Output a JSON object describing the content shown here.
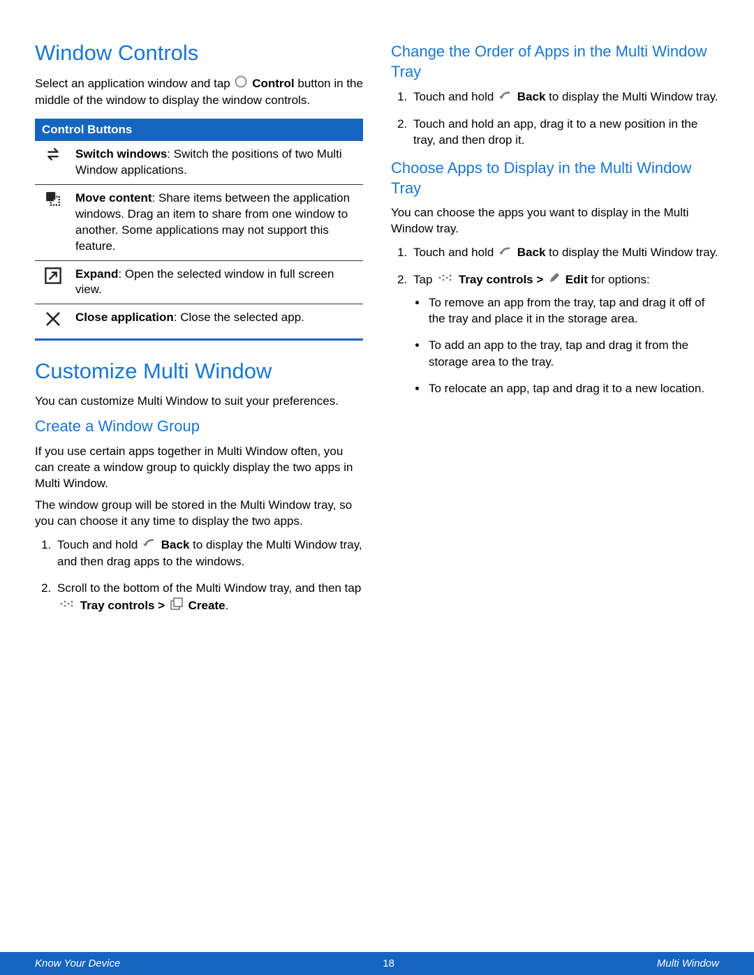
{
  "left": {
    "h1_windowControls": "Window Controls",
    "intro1a": "Select an application window and tap ",
    "intro1b": "Control",
    "intro1c": " button in the middle of the window to display the window controls.",
    "controlButtonsHeader": "Control Buttons",
    "rows": [
      {
        "icon": "switch",
        "bold": "Switch windows",
        "rest": ": Switch the positions of two Multi Window applications."
      },
      {
        "icon": "move",
        "bold": "Move content",
        "rest": ": Share items between the application windows. Drag an item to share from one window to another. Some applications may not support this feature."
      },
      {
        "icon": "expand",
        "bold": "Expand",
        "rest": ": Open the selected window in full screen view."
      },
      {
        "icon": "close",
        "bold": "Close application",
        "rest": ": Close the selected app."
      }
    ],
    "h1_customize": "Customize Multi Window",
    "customize_p": "You can customize Multi Window to suit your preferences.",
    "h2_createGroup": "Create a Window Group",
    "createGroup_p1": "If you use certain apps together in Multi Window often, you can create a window group to quickly display the two apps in Multi Window.",
    "createGroup_p2": "The window group will be stored in the Multi Window tray, so you can choose it any time to display the two apps.",
    "createGroup_li1a": "Touch and hold ",
    "createGroup_li1_back": "Back",
    "createGroup_li1b": " to display the Multi Window tray, and then drag apps to the windows.",
    "createGroup_li2a": "Scroll to the bottom of the Multi Window tray, and then tap ",
    "createGroup_li2_tray": "Tray controls > ",
    "createGroup_li2_create": "Create",
    "createGroup_li2b": "."
  },
  "right": {
    "h2_changeOrder": "Change the Order of Apps in the Multi Window Tray",
    "changeOrder_li1a": "Touch and hold ",
    "changeOrder_li1_back": "Back",
    "changeOrder_li1b": " to display the Multi Window tray.",
    "changeOrder_li2": "Touch and hold an app, drag it to a new position in the tray, and then drop it.",
    "h2_chooseApps": "Choose Apps to Display in the Multi Window Tray",
    "chooseApps_p": "You can choose the apps you want to display in the Multi Window tray.",
    "chooseApps_li1a": "Touch and hold ",
    "chooseApps_li1_back": "Back",
    "chooseApps_li1b": " to display the Multi Window tray.",
    "chooseApps_li2a": "Tap ",
    "chooseApps_li2_tray": "Tray controls > ",
    "chooseApps_li2_edit": "Edit",
    "chooseApps_li2b": " for options:",
    "chooseApps_sub1": "To remove an app from the tray, tap and drag it off of the tray and place it in the storage area.",
    "chooseApps_sub2": "To add an app to the tray, tap and drag it from the storage area to the tray.",
    "chooseApps_sub3": "To relocate an app, tap and drag it to a new location."
  },
  "footer": {
    "left": "Know Your Device",
    "center": "18",
    "right": "Multi Window"
  }
}
